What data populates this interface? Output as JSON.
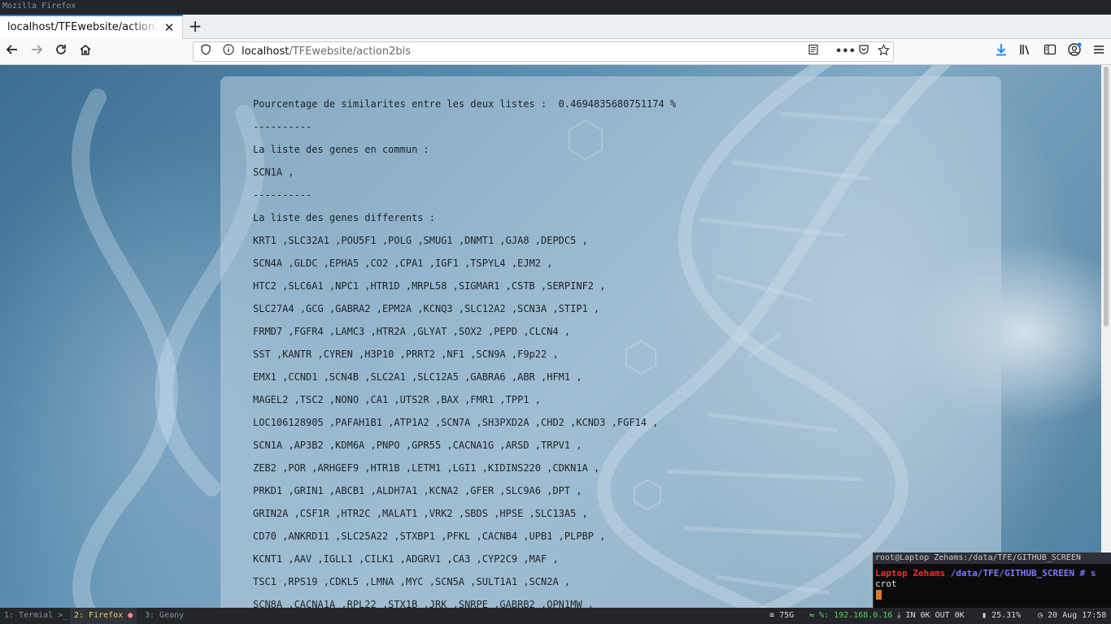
{
  "wm": {
    "title": "Mozilla Firefox"
  },
  "browser": {
    "tab_title": "localhost/TFEwebsite/action2bis",
    "url_host": "localhost",
    "url_path": "/TFEwebsite/action2bis"
  },
  "page": {
    "lines": [
      "Pourcentage de similarites entre les deux listes :  0.4694835680751174 %",
      "----------",
      "La liste des genes en commun :",
      "SCN1A ,",
      "----------",
      "La liste des genes differents :",
      "KRT1 ,SLC32A1 ,POU5F1 ,POLG ,SMUG1 ,DNMT1 ,GJA8 ,DEPDC5 ,",
      "SCN4A ,GLDC ,EPHA5 ,CO2 ,CPA1 ,IGF1 ,TSPYL4 ,EJM2 ,",
      "HTC2 ,SLC6A1 ,NPC1 ,HTR1D ,MRPL58 ,SIGMAR1 ,CSTB ,SERPINF2 ,",
      "SLC27A4 ,GCG ,GABRA2 ,EPM2A ,KCNQ3 ,SLC12A2 ,SCN3A ,STIP1 ,",
      "FRMD7 ,FGFR4 ,LAMC3 ,HTR2A ,GLYAT ,SOX2 ,PEPD ,CLCN4 ,",
      "SST ,KANTR ,CYREN ,H3P10 ,PRRT2 ,NF1 ,SCN9A ,F9p22 ,",
      "EMX1 ,CCND1 ,SCN4B ,SLC2A1 ,SLC12A5 ,GABRA6 ,ABR ,HFM1 ,",
      "MAGEL2 ,TSC2 ,NONO ,CA1 ,UTS2R ,BAX ,FMR1 ,TPP1 ,",
      "LOC106128905 ,PAFAH1B1 ,ATP1A2 ,SCN7A ,SH3PXD2A ,CHD2 ,KCND3 ,FGF14 ,",
      "SCN1A ,AP3B2 ,KDM6A ,PNPO ,GPR55 ,CACNA1G ,ARSD ,TRPV1 ,",
      "ZEB2 ,POR ,ARHGEF9 ,HTR1B ,LETM1 ,LGI1 ,KIDINS220 ,CDKN1A ,",
      "PRKD1 ,GRIN1 ,ABCB1 ,ALDH7A1 ,KCNA2 ,GFER ,SLC9A6 ,DPT ,",
      "GRIN2A ,CSF1R ,HTR2C ,MALAT1 ,VRK2 ,SBDS ,HPSE ,SLC13A5 ,",
      "CD70 ,ANKRD11 ,SLC25A22 ,STXBP1 ,PFKL ,CACNB4 ,UPB1 ,PLPBP ,",
      "KCNT1 ,AAV ,IGLL1 ,CILK1 ,ADGRV1 ,CA3 ,CYP2C9 ,MAF ,",
      "TSC1 ,RPS19 ,CDKL5 ,LMNA ,MYC ,SCN5A ,SULT1A1 ,SCN2A ,",
      "SCN8A ,CACNA1A ,RPL22 ,STX1B ,JRK ,SNRPE ,GABRB2 ,OPN1MW ,"
    ]
  },
  "terminal": {
    "title": "root@Laptop Zehams:/data/TFE/GITHUB_SCREEN",
    "prompt_host": "Laptop Zehams",
    "prompt_path": "/data/TFE/GITHUB_SCREEN",
    "prompt_symbol": "# s",
    "command_cont": "crot"
  },
  "taskbar": {
    "workspaces": [
      "1: Termial >_",
      "2: Firefox",
      "3: Geany"
    ],
    "disk": "75G",
    "ip_label": "%: 192.168.0.16",
    "net": "IN 0K OUT 0K",
    "cpu": "25.31%",
    "datetime": "20 Aug 17:58"
  },
  "colors": {
    "accent": "#0a84ff",
    "terminal_host": "#ff2a2a",
    "terminal_path": "#7a7aff",
    "ip": "#57d05a",
    "active_ws": "#e8d36a"
  }
}
